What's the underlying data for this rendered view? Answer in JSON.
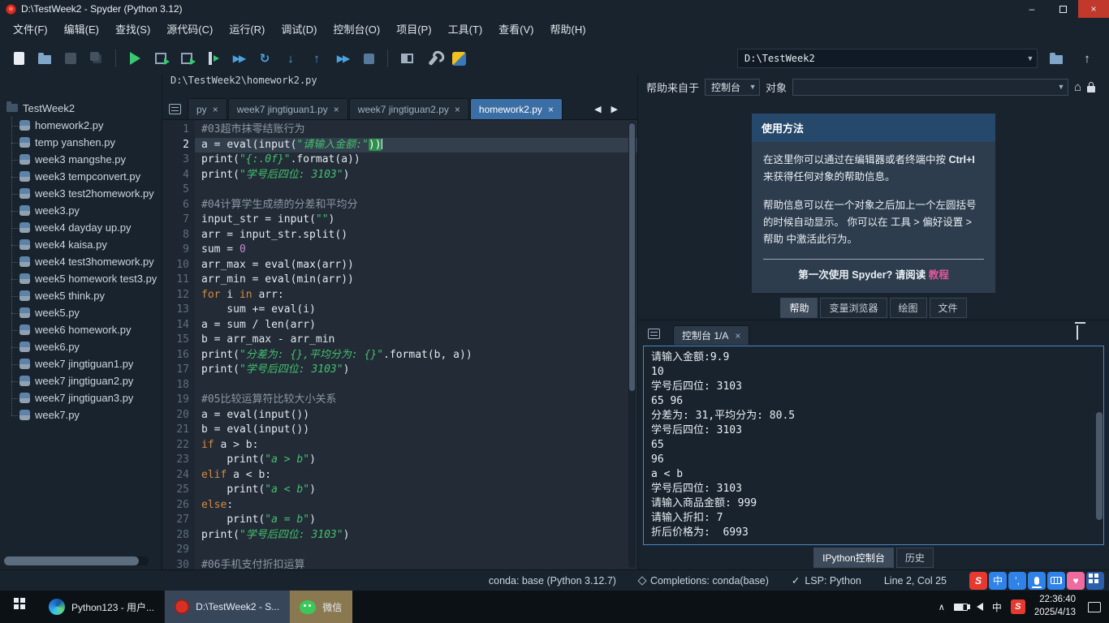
{
  "titlebar": {
    "title": "D:\\TestWeek2 - Spyder (Python 3.12)"
  },
  "menubar": {
    "items": [
      "文件(F)",
      "编辑(E)",
      "查找(S)",
      "源代码(C)",
      "运行(R)",
      "调试(D)",
      "控制台(O)",
      "项目(P)",
      "工具(T)",
      "查看(V)",
      "帮助(H)"
    ]
  },
  "toolbar": {
    "workdir_value": "D:\\TestWeek2"
  },
  "project": {
    "root": "TestWeek2",
    "files": [
      "homework2.py",
      "temp yanshen.py",
      "week3 mangshe.py",
      "week3 tempconvert.py",
      "week3 test2homework.py",
      "week3.py",
      "week4 dayday up.py",
      "week4 kaisa.py",
      "week4 test3homework.py",
      "week5 homework test3.py",
      "week5 think.py",
      "week5.py",
      "week6 homework.py",
      "week6.py",
      "week7 jingtiguan1.py",
      "week7 jingtiguan2.py",
      "week7 jingtiguan3.py",
      "week7.py"
    ]
  },
  "editor": {
    "path": "D:\\TestWeek2\\homework2.py",
    "tabs": [
      {
        "label": "py",
        "active": false
      },
      {
        "label": "week7 jingtiguan1.py",
        "active": false
      },
      {
        "label": "week7 jingtiguan2.py",
        "active": false
      },
      {
        "label": "homework2.py",
        "active": true
      }
    ],
    "lines": [
      {
        "n": 1,
        "segs": [
          [
            "c",
            "#03超市抹零结账行为"
          ]
        ]
      },
      {
        "n": 2,
        "hl": true,
        "segs": [
          [
            "p",
            "a = "
          ],
          [
            "b",
            "eval"
          ],
          [
            "p",
            "("
          ],
          [
            "b",
            "input"
          ],
          [
            "p",
            "("
          ],
          [
            "s",
            "\"请输入金额:\""
          ],
          [
            "m",
            "))"
          ],
          [
            "caret",
            ""
          ]
        ]
      },
      {
        "n": 3,
        "segs": [
          [
            "b",
            "print"
          ],
          [
            "p",
            "("
          ],
          [
            "s",
            "\"{:.0f}\""
          ],
          [
            "p",
            "."
          ],
          [
            "b",
            "format"
          ],
          [
            "p",
            "(a))"
          ]
        ]
      },
      {
        "n": 4,
        "segs": [
          [
            "b",
            "print"
          ],
          [
            "p",
            "("
          ],
          [
            "s",
            "\"学号后四位: 3103\""
          ],
          [
            "p",
            ")"
          ]
        ]
      },
      {
        "n": 5,
        "segs": []
      },
      {
        "n": 6,
        "segs": [
          [
            "c",
            "#04计算学生成绩的分差和平均分"
          ]
        ]
      },
      {
        "n": 7,
        "segs": [
          [
            "p",
            "input_str = "
          ],
          [
            "b",
            "input"
          ],
          [
            "p",
            "("
          ],
          [
            "s",
            "\"\""
          ],
          [
            "p",
            ")"
          ]
        ]
      },
      {
        "n": 8,
        "segs": [
          [
            "p",
            "arr = input_str."
          ],
          [
            "b",
            "split"
          ],
          [
            "p",
            "()"
          ]
        ]
      },
      {
        "n": 9,
        "segs": [
          [
            "p",
            "sum = "
          ],
          [
            "n",
            "0"
          ]
        ]
      },
      {
        "n": 10,
        "segs": [
          [
            "p",
            "arr_max = "
          ],
          [
            "b",
            "eval"
          ],
          [
            "p",
            "("
          ],
          [
            "b",
            "max"
          ],
          [
            "p",
            "(arr))"
          ]
        ]
      },
      {
        "n": 11,
        "segs": [
          [
            "p",
            "arr_min = "
          ],
          [
            "b",
            "eval"
          ],
          [
            "p",
            "("
          ],
          [
            "b",
            "min"
          ],
          [
            "p",
            "(arr))"
          ]
        ]
      },
      {
        "n": 12,
        "segs": [
          [
            "k",
            "for"
          ],
          [
            "p",
            " i "
          ],
          [
            "k",
            "in"
          ],
          [
            "p",
            " arr:"
          ]
        ]
      },
      {
        "n": 13,
        "segs": [
          [
            "p",
            "    sum += "
          ],
          [
            "b",
            "eval"
          ],
          [
            "p",
            "(i)"
          ]
        ]
      },
      {
        "n": 14,
        "segs": [
          [
            "p",
            "a = sum / "
          ],
          [
            "b",
            "len"
          ],
          [
            "p",
            "(arr)"
          ]
        ]
      },
      {
        "n": 15,
        "segs": [
          [
            "p",
            "b = arr_max - arr_min"
          ]
        ]
      },
      {
        "n": 16,
        "segs": [
          [
            "b",
            "print"
          ],
          [
            "p",
            "("
          ],
          [
            "s",
            "\"分差为: {},平均分为: {}\""
          ],
          [
            "p",
            "."
          ],
          [
            "b",
            "format"
          ],
          [
            "p",
            "(b, a))"
          ]
        ]
      },
      {
        "n": 17,
        "segs": [
          [
            "b",
            "print"
          ],
          [
            "p",
            "("
          ],
          [
            "s",
            "\"学号后四位: 3103\""
          ],
          [
            "p",
            ")"
          ]
        ]
      },
      {
        "n": 18,
        "segs": []
      },
      {
        "n": 19,
        "segs": [
          [
            "c",
            "#05比较运算符比较大小关系"
          ]
        ]
      },
      {
        "n": 20,
        "segs": [
          [
            "p",
            "a = "
          ],
          [
            "b",
            "eval"
          ],
          [
            "p",
            "("
          ],
          [
            "b",
            "input"
          ],
          [
            "p",
            "())"
          ]
        ]
      },
      {
        "n": 21,
        "segs": [
          [
            "p",
            "b = "
          ],
          [
            "b",
            "eval"
          ],
          [
            "p",
            "("
          ],
          [
            "b",
            "input"
          ],
          [
            "p",
            "())"
          ]
        ]
      },
      {
        "n": 22,
        "segs": [
          [
            "k",
            "if"
          ],
          [
            "p",
            " a > b:"
          ]
        ]
      },
      {
        "n": 23,
        "segs": [
          [
            "p",
            "    "
          ],
          [
            "b",
            "print"
          ],
          [
            "p",
            "("
          ],
          [
            "s",
            "\"a > b\""
          ],
          [
            "p",
            ")"
          ]
        ]
      },
      {
        "n": 24,
        "segs": [
          [
            "k",
            "elif"
          ],
          [
            "p",
            " a < b:"
          ]
        ]
      },
      {
        "n": 25,
        "segs": [
          [
            "p",
            "    "
          ],
          [
            "b",
            "print"
          ],
          [
            "p",
            "("
          ],
          [
            "s",
            "\"a < b\""
          ],
          [
            "p",
            ")"
          ]
        ]
      },
      {
        "n": 26,
        "segs": [
          [
            "k",
            "else"
          ],
          [
            "p",
            ":"
          ]
        ]
      },
      {
        "n": 27,
        "segs": [
          [
            "p",
            "    "
          ],
          [
            "b",
            "print"
          ],
          [
            "p",
            "("
          ],
          [
            "s",
            "\"a = b\""
          ],
          [
            "p",
            ")"
          ]
        ]
      },
      {
        "n": 28,
        "segs": [
          [
            "b",
            "print"
          ],
          [
            "p",
            "("
          ],
          [
            "s",
            "\"学号后四位: 3103\""
          ],
          [
            "p",
            ")"
          ]
        ]
      },
      {
        "n": 29,
        "segs": []
      },
      {
        "n": 30,
        "segs": [
          [
            "c",
            "#06手机支付折扣运算"
          ]
        ]
      }
    ]
  },
  "help": {
    "source_label": "帮助来自于",
    "source_value": "控制台",
    "object_label": "对象",
    "object_value": "",
    "card": {
      "title": "使用方法",
      "para1_pre": "在这里你可以通过在编辑器或者终端中按 ",
      "para1_key": "Ctrl+I",
      "para1_post": " 来获得任何对象的帮助信息。",
      "para2": "帮助信息可以在一个对象之后加上一个左圆括号的时候自动显示。 你可以在 工具 > 偏好设置 > 帮助 中激活此行为。",
      "footer_pre": "第一次使用 Spyder? 请阅读 ",
      "footer_link": "教程"
    },
    "dock_tabs": [
      {
        "label": "帮助",
        "active": true
      },
      {
        "label": "变量浏览器",
        "active": false
      },
      {
        "label": "绘图",
        "active": false
      },
      {
        "label": "文件",
        "active": false
      }
    ]
  },
  "console": {
    "tab": "控制台 1/A",
    "lines": [
      "请输入金额:9.9",
      "10",
      "学号后四位: 3103",
      "65 96",
      "分差为: 31,平均分为: 80.5",
      "学号后四位: 3103",
      "65",
      "96",
      "a < b",
      "学号后四位: 3103",
      "请输入商品金额: 999",
      "请输入折扣: 7",
      "折后价格为:  6993"
    ],
    "dock_tabs": [
      {
        "label": "IPython控制台",
        "active": true
      },
      {
        "label": "历史",
        "active": false
      }
    ]
  },
  "statusbar": {
    "conda": "conda: base (Python 3.12.7)",
    "completions": "Completions: conda(base)",
    "lsp": "LSP: Python",
    "cursor": "Line 2, Col 25",
    "ime_logo": "S",
    "ime_lang": "中",
    "ime_punct": "’,"
  },
  "taskbar": {
    "tasks": [
      {
        "label": "Python123 - 用户...",
        "icon": "edge",
        "active": false
      },
      {
        "label": "D:\\TestWeek2 - S...",
        "icon": "spyder",
        "active": true
      },
      {
        "label": "微信",
        "icon": "wechat",
        "active": false
      }
    ],
    "tray": {
      "lang": "中",
      "sogou": "S",
      "time": "22:36:40",
      "date": "2025/4/13"
    }
  }
}
